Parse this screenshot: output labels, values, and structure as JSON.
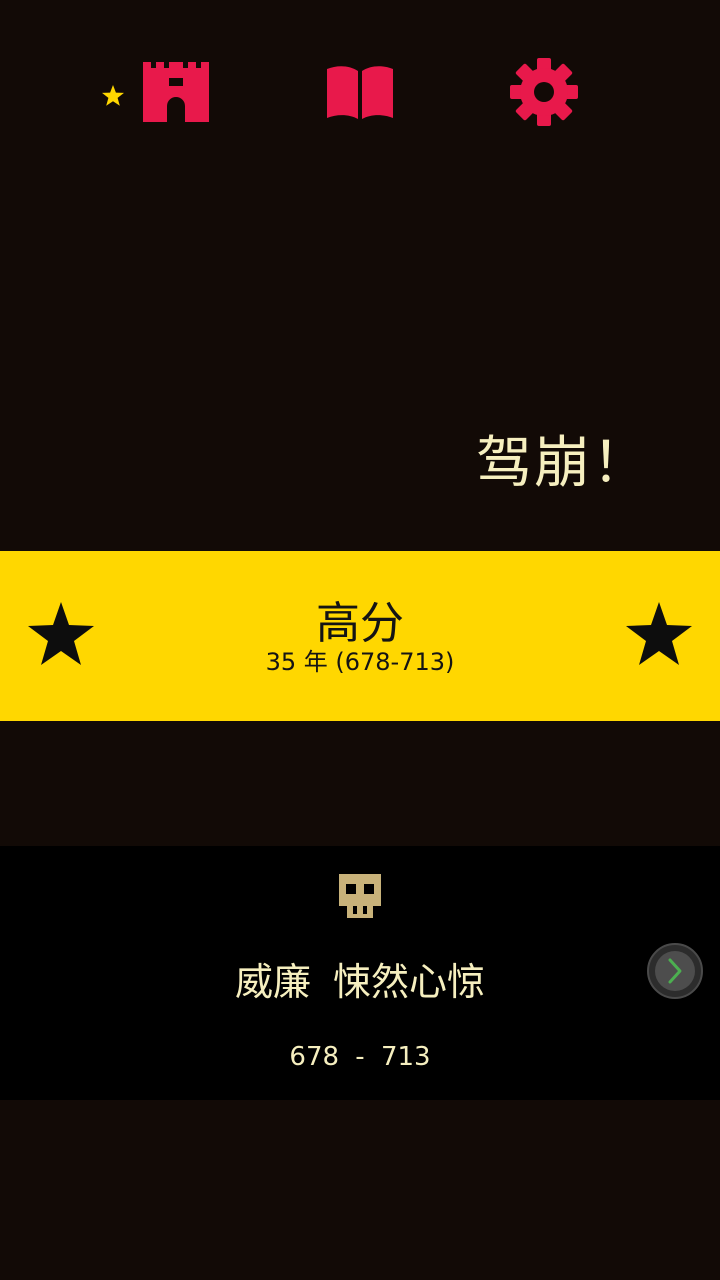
{
  "colors": {
    "background": "#120a06",
    "accent_red": "#e8194b",
    "gold": "#ffd700",
    "cream": "#f6efbf",
    "skull": "#c8b27a",
    "arrow_green": "#4caf50"
  },
  "topbar": {
    "icons": [
      "castle-icon",
      "book-icon",
      "gear-icon"
    ],
    "new_indicator": "star-icon"
  },
  "headline": "驾崩！",
  "highscore": {
    "title": "高分",
    "subtitle": "35 年 (678-713)"
  },
  "result": {
    "icon": "skull-icon",
    "name": "威廉 悚然心惊",
    "years": "678 - 713",
    "next_icon": "chevron-right-icon"
  }
}
